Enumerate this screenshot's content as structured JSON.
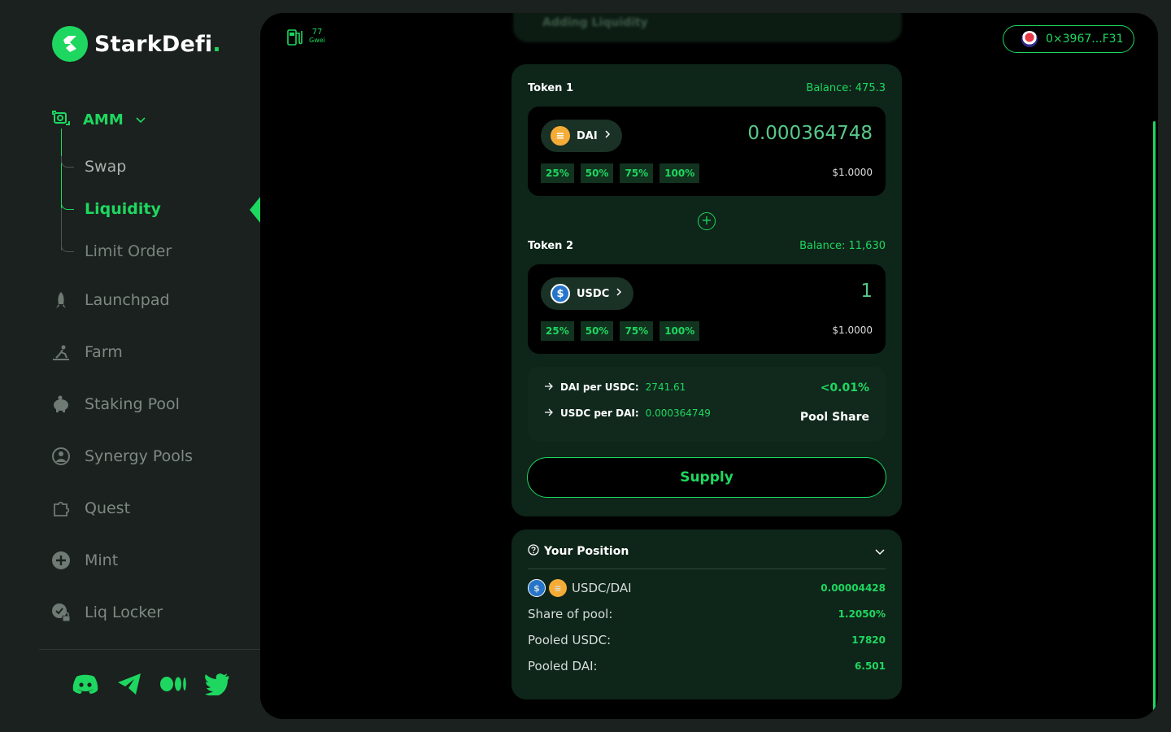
{
  "brand": {
    "name": "StarkDefi",
    "dot": ".",
    "accent": "#1ed760"
  },
  "nav": {
    "amm": {
      "label": "AMM",
      "icon": "amm-icon"
    },
    "amm_children": [
      {
        "label": "Swap"
      },
      {
        "label": "Liquidity",
        "active": true
      },
      {
        "label": "Limit Order"
      }
    ],
    "items": [
      {
        "label": "Launchpad",
        "icon": "rocket-icon"
      },
      {
        "label": "Farm",
        "icon": "farm-icon"
      },
      {
        "label": "Staking Pool",
        "icon": "piggy-bank-icon"
      },
      {
        "label": "Synergy Pools",
        "icon": "synergy-icon"
      },
      {
        "label": "Quest",
        "icon": "puzzle-icon"
      },
      {
        "label": "Mint",
        "icon": "plus-circle-icon"
      },
      {
        "label": "Liq Locker",
        "icon": "lock-icon"
      }
    ],
    "socials": [
      "discord-icon",
      "telegram-icon",
      "medium-icon",
      "twitter-icon"
    ]
  },
  "header": {
    "gas": {
      "value": "77",
      "unit": "Gwei"
    },
    "wallet": "0×3967...F31",
    "blurred_title": "Adding Liquidity"
  },
  "token1": {
    "label": "Token 1",
    "balance": "Balance: 475.3",
    "symbol": "DAI",
    "amount": "0.000364748",
    "usd": "$1.0000",
    "pcts": [
      "25%",
      "50%",
      "75%",
      "100%"
    ]
  },
  "token2": {
    "label": "Token 2",
    "balance": "Balance: 11,630",
    "symbol": "USDC",
    "amount": "1",
    "usd": "$1.0000",
    "pcts": [
      "25%",
      "50%",
      "75%",
      "100%"
    ]
  },
  "rates": {
    "dai_per_usdc_label": "DAI per USDC:",
    "dai_per_usdc": "2741.61",
    "usdc_per_dai_label": "USDC per DAI:",
    "usdc_per_dai": "0.000364749",
    "pool_share_value": "<0.01%",
    "pool_share_label": "Pool Share"
  },
  "supply_label": "Supply",
  "position": {
    "title": "Your Position",
    "pair": "USDC/DAI",
    "pair_value": "0.00004428",
    "rows": [
      {
        "label": "Share of pool:",
        "value": "1.2050%"
      },
      {
        "label": "Pooled USDC:",
        "value": "17820"
      },
      {
        "label": "Pooled DAI:",
        "value": "6.501"
      }
    ]
  }
}
